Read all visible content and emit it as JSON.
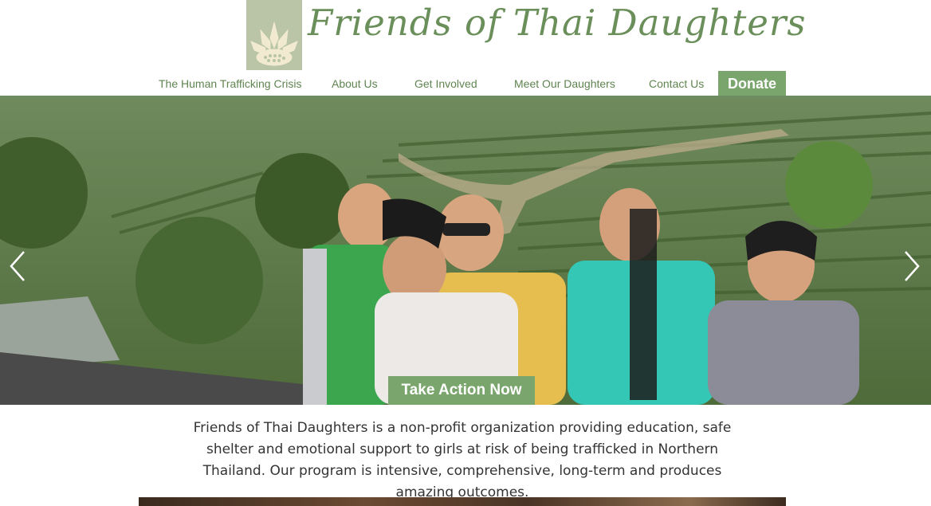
{
  "header": {
    "logo_title": "Friends of Thai Daughters",
    "logo_icon": "lotus-icon",
    "logo_color": "#b9c5a6",
    "title_color": "#6b8f5a"
  },
  "nav": {
    "items": [
      {
        "label": "The Human Trafficking Crisis"
      },
      {
        "label": "About Us"
      },
      {
        "label": "Get Involved"
      },
      {
        "label": "Meet Our Daughters"
      },
      {
        "label": "Contact Us"
      }
    ],
    "donate_label": "Donate",
    "accent": "#7aa56c"
  },
  "hero": {
    "cta_label": "Take Action Now",
    "prev_icon": "chevron-left-icon",
    "next_icon": "chevron-right-icon"
  },
  "mission": {
    "text": "Friends of Thai Daughters is a non-profit organization providing education, safe shelter and emotional support to girls at risk of being trafficked in Northern Thailand. Our program is intensive, comprehensive, long-term and produces amazing outcomes."
  }
}
